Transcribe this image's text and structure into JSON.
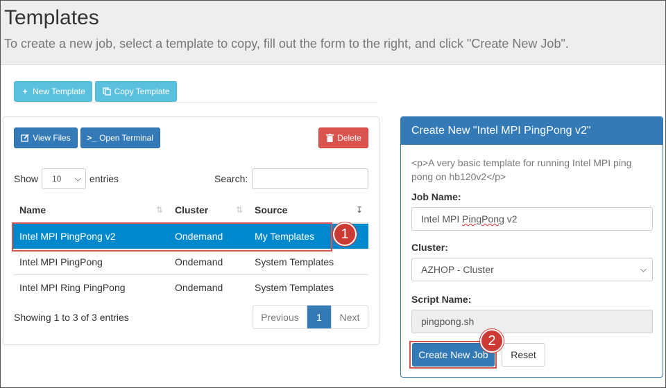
{
  "header": {
    "title": "Templates",
    "subtitle": "To create a new job, select a template to copy, fill out the form to the right, and click \"Create New Job\"."
  },
  "toolbar": {
    "new_template": "New Template",
    "copy_template": "Copy Template"
  },
  "left_panel": {
    "view_files": "View Files",
    "open_terminal": "Open Terminal",
    "delete": "Delete",
    "show_label": "Show",
    "entries_value": "10",
    "entries_label": "entries",
    "search_label": "Search:",
    "search_value": "",
    "columns": [
      "Name",
      "Cluster",
      "Source"
    ],
    "rows": [
      {
        "name": "Intel MPI PingPong v2",
        "cluster": "Ondemand",
        "source": "My Templates",
        "selected": true
      },
      {
        "name": "Intel MPI PingPong",
        "cluster": "Ondemand",
        "source": "System Templates",
        "selected": false
      },
      {
        "name": "Intel MPI Ring PingPong",
        "cluster": "Ondemand",
        "source": "System Templates",
        "selected": false
      }
    ],
    "info": "Showing 1 to 3 of 3 entries",
    "pager": {
      "prev": "Previous",
      "current": "1",
      "next": "Next"
    }
  },
  "right_panel": {
    "title": "Create New \"Intel MPI PingPong v2\"",
    "description": "<p>A very basic template for running Intel MPI ping pong on hb120v2</p>",
    "job_name_label": "Job Name:",
    "job_name_prefix": "Intel MPI ",
    "job_name_word": "PingPong",
    "job_name_suffix": " v2",
    "cluster_label": "Cluster:",
    "cluster_value": "AZHOP - Cluster",
    "script_label": "Script Name:",
    "script_value": "pingpong.sh",
    "create_button": "Create New Job",
    "reset_button": "Reset"
  },
  "annotations": {
    "badge1": "1",
    "badge2": "2"
  },
  "icons": {
    "plus": "plus-icon",
    "copy": "copy-icon",
    "edit": "edit-icon",
    "terminal": "terminal-icon",
    "trash": "trash-icon",
    "sort": "sort-icon",
    "caret": "chevron-down-icon"
  },
  "colors": {
    "primary": "#337ab7",
    "info": "#5bc0de",
    "danger": "#d9534f",
    "selected_row": "#0088cc",
    "annotation": "#cc3b33"
  }
}
